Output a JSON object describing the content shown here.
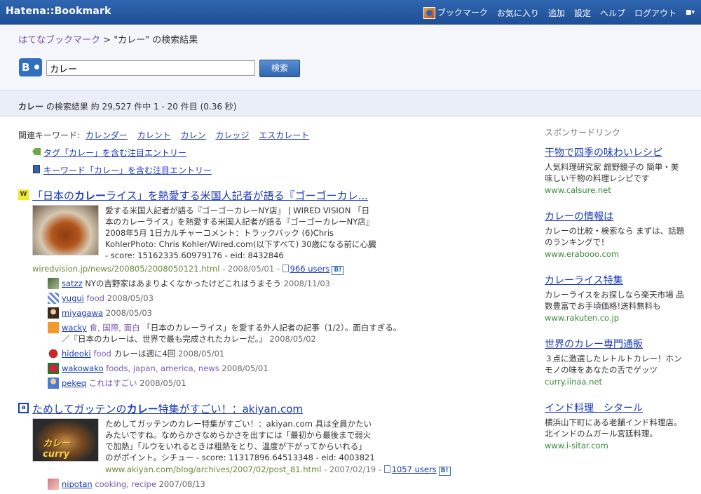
{
  "header": {
    "logo": "Hatena::Bookmark",
    "nav": [
      "ブックマーク",
      "お気に入り",
      "追加",
      "設定",
      "ヘルプ",
      "ログアウト"
    ]
  },
  "breadcrumb": {
    "home": "はてなブックマーク",
    "separator": " > ",
    "current": "\"カレー\" の検索結果"
  },
  "search": {
    "value": "カレー",
    "button": "検索"
  },
  "summary": {
    "keyword": "カレー",
    "text": " の検索結果 約 29,527 件中 1 - 20 件目 (0.36 秒)"
  },
  "related": {
    "label": "関連キーワード:",
    "keywords": [
      "カレンダー",
      "カレント",
      "カレン",
      "カレッジ",
      "エスカレート"
    ],
    "tag_entries": "タグ「カレー」を含む注目エントリー",
    "keyword_entries": "キーワード「カレー」を含む注目エントリー"
  },
  "entries": [
    {
      "title_prefix": "「日本の",
      "title_bold": "カレー",
      "title_suffix": "ライス」を熱愛する米国人記者が語る『ゴーゴーカレ...",
      "snippet": [
        "愛する米国人記者が語る『ゴーゴーカレーNY店』 | WIRED VISION 「日",
        "本のカレーライス」を熱愛する米国人記者が語る『ゴーゴーカレーNY店』",
        "2008年5月 1日カルチャーコメント：トラックバック (6)Chris",
        "KohlerPhoto: Chris Kohler/Wired.com(以下すべて) 30歳になる前に心臓",
        "- score: 15162335.60979176 - eid: 8432846"
      ],
      "url": "wiredvision.jp/news/200805/2008050121.html",
      "date": " - 2008/05/01 - ",
      "users": "966 users",
      "badge": "B!",
      "comments": [
        {
          "user": "satzz",
          "tags": "",
          "text": " NYの吉野家はあまりよくなかったけどこれはうまそう",
          "date": " 2008/11/03"
        },
        {
          "user": "yugui",
          "tags": " food",
          "text": "",
          "date": " 2008/05/03"
        },
        {
          "user": "miyagawa",
          "tags": "",
          "text": "",
          "date": " 2008/05/03"
        },
        {
          "user": "wacky",
          "tags": " 食, 国際, 面白",
          "text": " 「日本のカレーライス」を愛する外人記者の記事（1/2）。面白すぎる。",
          "text2": "／『日本のカレーは、世界で最も完成されたカレーだ。』",
          "date": " 2008/05/02"
        },
        {
          "user": "hideoki",
          "tags": " food",
          "text": " カレーは週に4回",
          "date": " 2008/05/01"
        },
        {
          "user": "wakowako",
          "tags": " foods, japan, america, news",
          "text": "",
          "date": " 2008/05/01"
        },
        {
          "user": "pekeq",
          "tags": " これはすごい",
          "text": "",
          "date": " 2008/05/01"
        }
      ]
    },
    {
      "title_prefix": "ためしてガッテンの",
      "title_bold": "カレー",
      "title_suffix": "特集がすごい！：akiyan.com",
      "snippet": [
        "ためしてガッテンのカレー特集がすごい！：akiyan.com 具は全員かたい",
        "みたいですね。なめらかさなめらかさを出すには「最初から最後まで弱火",
        "で加熱」「ルウをいれるときは粗熱をとり、温度が下がってからいれる」",
        "のがポイント。シチュー - score: 11317896.64513348 - eid: 4003821"
      ],
      "thumb_text": "カレー curry",
      "url": "www.akiyan.com/blog/archives/2007/02/post_81.html",
      "date": " - 2007/02/19 - ",
      "users": "1057 users",
      "badge": "B!",
      "comments": [
        {
          "user": "nipotan",
          "tags": " cooking, recipe",
          "text": "",
          "date": " 2007/08/13"
        }
      ]
    }
  ],
  "sidebar": {
    "heading": "スポンサードリンク",
    "ads": [
      {
        "title": "干物で四季の味わいレシピ",
        "desc": "人気料理研究家 舘野鏡子の 簡単・美味しい干物の料理レシピです",
        "url": "www.calsure.net"
      },
      {
        "title": "カレーの情報は",
        "desc": "カレーの比較・検索なら まずは、話題のランキングで！",
        "url": "www.erabooo.com"
      },
      {
        "title": "カレーライス特集",
        "desc": "カレーライスをお探しなら楽天市場 品数豊富でお手頃価格!送料無料も",
        "url": "www.rakuten.co.jp"
      },
      {
        "title": "世界のカレー専門通販",
        "desc": "３点に激選したレトルトカレー！ホンモノの味をあなたの舌でゲッツ",
        "url": "curry.iinaa.net"
      },
      {
        "title": "インド料理　シタール",
        "desc": "横浜山下町にある老舗インド料理店。 北インドのムガール宮廷料理。",
        "url": "www.i-sitar.com"
      }
    ]
  }
}
